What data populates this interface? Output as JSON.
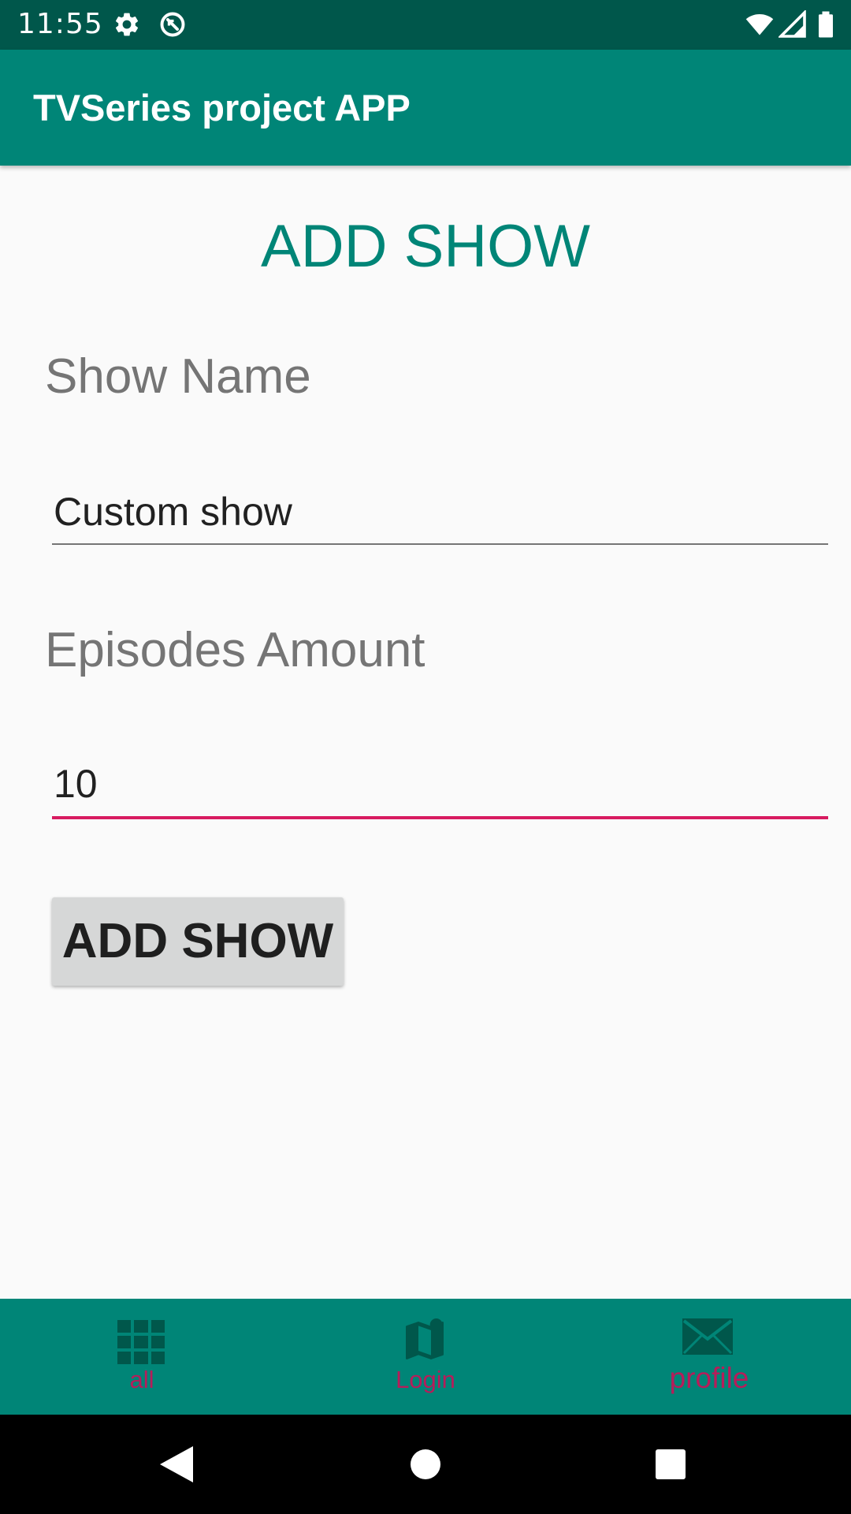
{
  "status_bar": {
    "time": "11:55",
    "icons": [
      "settings-icon",
      "sync-icon",
      "wifi-icon",
      "signal-icon",
      "battery-icon"
    ]
  },
  "app_bar": {
    "title": "TVSeries project APP"
  },
  "form": {
    "heading": "ADD SHOW",
    "show_name_label": "Show Name",
    "show_name_value": "Custom show",
    "episodes_label": "Episodes Amount",
    "episodes_value": "10",
    "submit_label": "ADD SHOW"
  },
  "bottom_nav": {
    "items": [
      {
        "label": "all",
        "icon": "grid-icon"
      },
      {
        "label": "Login",
        "icon": "map-icon"
      },
      {
        "label": "profile",
        "icon": "mail-icon"
      }
    ]
  },
  "system_nav": {
    "buttons": [
      "back-icon",
      "home-icon",
      "recents-icon"
    ]
  },
  "colors": {
    "status_bar": "#00574b",
    "primary": "#008577",
    "accent": "#d81b60",
    "background": "#fafafa",
    "button": "#d6d7d7"
  }
}
